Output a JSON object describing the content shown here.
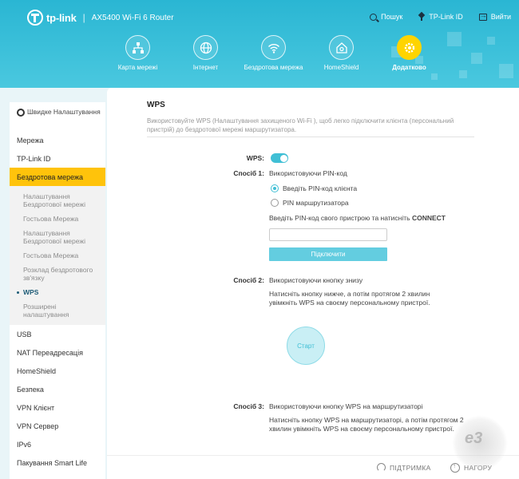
{
  "colors": {
    "header": "#2ab6d3",
    "accent": "#40bfd5",
    "active_nav": "#ffd400",
    "active_side": "#ffc30b"
  },
  "header": {
    "brand": "tp-link",
    "separator": "|",
    "model": "AX5400 Wi-Fi 6 Router",
    "links": [
      {
        "label": "Пошук",
        "icon": "search-icon"
      },
      {
        "label": "TP-Link ID",
        "icon": "tplink-id-icon"
      },
      {
        "label": "Вийти",
        "icon": "logout-icon"
      }
    ]
  },
  "nav": [
    {
      "label": "Карта мережі",
      "icon": "network-map-icon",
      "active": false
    },
    {
      "label": "Інтернет",
      "icon": "globe-icon",
      "active": false
    },
    {
      "label": "Бездротова мережа",
      "icon": "wifi-icon",
      "active": false
    },
    {
      "label": "HomeShield",
      "icon": "home-shield-icon",
      "active": false
    },
    {
      "label": "Додатково",
      "icon": "gear-icon",
      "active": true
    }
  ],
  "sidebar": {
    "quick_setup": "Швидке Налаштування",
    "items_before": [
      "Мережа",
      "TP-Link ID"
    ],
    "active_section": "Бездротова мережа",
    "sub_items": [
      {
        "label": "Налаштування Бездротової мережі",
        "active": false
      },
      {
        "label": "Гостьова Мережа",
        "active": false
      },
      {
        "label": "Налаштування Бездротової мережі",
        "active": false
      },
      {
        "label": "Гостьова Мережа",
        "active": false
      },
      {
        "label": "Розклад бездротового зв'язку",
        "active": false
      },
      {
        "label": "WPS",
        "active": true
      },
      {
        "label": "Розширені налаштування",
        "active": false
      }
    ],
    "items_after": [
      "USB",
      "NAT Переадресація",
      "HomeShield",
      "Безпека",
      "VPN Клієнт",
      "VPN Сервер",
      "IPv6",
      "Пакування Smart Life"
    ]
  },
  "main": {
    "title": "WPS",
    "description": "Використовуйте WPS (Налаштування захищеного Wi-Fi ), щоб легко підключити клієнта (персональний пристрій) до бездротової мережі маршрутизатора.",
    "wps_label": "WPS:",
    "wps_enabled": true,
    "method1": {
      "label": "Спосіб 1:",
      "title": "Використовуючи PIN-код",
      "options": [
        {
          "label": "Введіть PIN-код клієнта",
          "checked": true
        },
        {
          "label": "PIN маршрутизатора",
          "checked": false
        }
      ],
      "instruction_prefix": "Введіть PIN-код свого пристрою та натисніть ",
      "instruction_bold": "CONNECT",
      "pin_value": "",
      "connect_button": "Підключити"
    },
    "method2": {
      "label": "Спосіб 2:",
      "title": "Використовуючи кнопку знизу",
      "instruction": "Натисніть кнопку нижче, а потім протягом 2 хвилин увімкніть WPS на своєму персональному пристрої.",
      "start_button": "Старт"
    },
    "method3": {
      "label": "Спосіб 3:",
      "title": "Використовуючи кнопку WPS на маршрутизаторі",
      "instruction": "Натисніть кнопку WPS на маршрутизаторі, а потім протягом 2 хвилин увімкніть WPS на своєму персональному пристрої."
    }
  },
  "footer": {
    "support": "ПІДТРИМКА",
    "back_to_top": "НАГОРУ"
  },
  "watermark": "e3"
}
